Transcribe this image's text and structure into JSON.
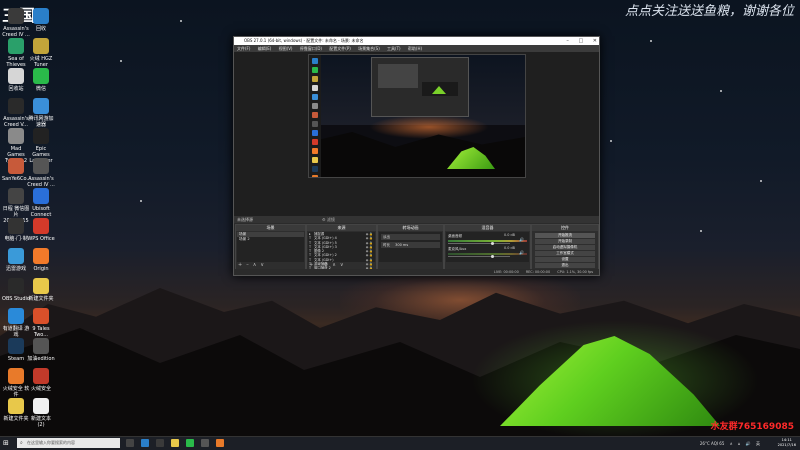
{
  "banner_text": "点点关注送送鱼粮，谢谢各位",
  "top_logo": "三国",
  "qq_group": "水友群765169085",
  "desktop_icons": [
    {
      "label": "Assassin's Creed IV ...",
      "color": "#3a3a3a"
    },
    {
      "label": "回收",
      "color": "#2a7fc9"
    },
    {
      "label": "Sea of Thieves",
      "color": "#2aa06a"
    },
    {
      "label": "火绒 HGZ Tuner",
      "color": "#c2a53a"
    },
    {
      "label": "回收站",
      "color": "#d6d6d6"
    },
    {
      "label": "微信",
      "color": "#2aba4a"
    },
    {
      "label": "Assassin's Creed V...",
      "color": "#2a2a2a"
    },
    {
      "label": "腾讯网游加速器",
      "color": "#3a8fd9"
    },
    {
      "label": "Mad Games Tycoon 2",
      "color": "#8a8a8a"
    },
    {
      "label": "Epic Games Launcher",
      "color": "#222222"
    },
    {
      "label": "SanYe6Co...",
      "color": "#c75a3a"
    },
    {
      "label": "Assassin's Creed IV ...",
      "color": "#555555"
    },
    {
      "label": "日程 微信图片 20211015",
      "color": "#444444"
    },
    {
      "label": "Ubisoft Connect",
      "color": "#2a6fd9"
    },
    {
      "label": "电脑·门·制",
      "color": "#333333"
    },
    {
      "label": "WPS Office",
      "color": "#d33a2a"
    },
    {
      "label": "迅雷游戏",
      "color": "#3a9ad9"
    },
    {
      "label": "Origin",
      "color": "#f27a2a"
    },
    {
      "label": "OBS Studio",
      "color": "#2a2a2a"
    },
    {
      "label": "新建文件夹",
      "color": "#e8c84a"
    },
    {
      "label": "有道翻译 游戏",
      "color": "#2a8ad9"
    },
    {
      "label": "9 Tales Two...",
      "color": "#d9502a"
    },
    {
      "label": "Steam",
      "color": "#1b3a5a"
    },
    {
      "label": "加油edition",
      "color": "#555555"
    },
    {
      "label": "火绒安全 软件",
      "color": "#e87a2a"
    },
    {
      "label": "火绒安全",
      "color": "#c23a2a"
    },
    {
      "label": "新建文件夹",
      "color": "#e8c84a"
    },
    {
      "label": "新建文本 (2)",
      "color": "#f0f0f0"
    }
  ],
  "obs": {
    "title": "OBS 27.0.1 (64-bit, windows) - 配置文件: 未命名 - 场景: 未命名",
    "menu": [
      "文件(F)",
      "编辑(E)",
      "视图(V)",
      "停靠窗口(D)",
      "配置文件(P)",
      "场景集合(S)",
      "工具(T)",
      "帮助(H)"
    ],
    "midbar_label": "未选择源",
    "midbar_icons": "⚙ 滤镜",
    "docks": {
      "scenes": {
        "title": "场景",
        "items": [
          "场景",
          "场景 2"
        ]
      },
      "sources": {
        "title": "来源",
        "items": [
          "捕捉源",
          "文本 (GDI+) 4",
          "文本 (GDI+) 5",
          "文本 (GDI+) 3",
          "图像 2",
          "文本 (GDI+) 2",
          "文本 (GDI+)",
          "游戏捕获",
          "窗口捕获 2"
        ]
      },
      "transitions": {
        "title": "转场动画",
        "type": "淡出",
        "duration_label": "时长",
        "duration": "300 ms"
      },
      "mixer": {
        "title": "混音器",
        "tracks": [
          {
            "name": "桌面音频",
            "db": "0.0 dB"
          },
          {
            "name": "麦克风/Aux",
            "db": "0.0 dB"
          }
        ]
      },
      "controls": {
        "title": "控件",
        "buttons": [
          "开始推流",
          "开始录制",
          "启动虚拟摄像机",
          "工作室模式",
          "设置",
          "退出"
        ]
      }
    },
    "status": [
      "LIVE: 00:00:00",
      "REC: 00:00:00",
      "CPU: 1.1%, 30.00 fps"
    ]
  },
  "taskbar": {
    "search_placeholder": "在这里输入你要搜索的内容",
    "weather": "26°C AQI 65",
    "ime": "英",
    "time": "14:11",
    "date": "2021/7/16"
  }
}
